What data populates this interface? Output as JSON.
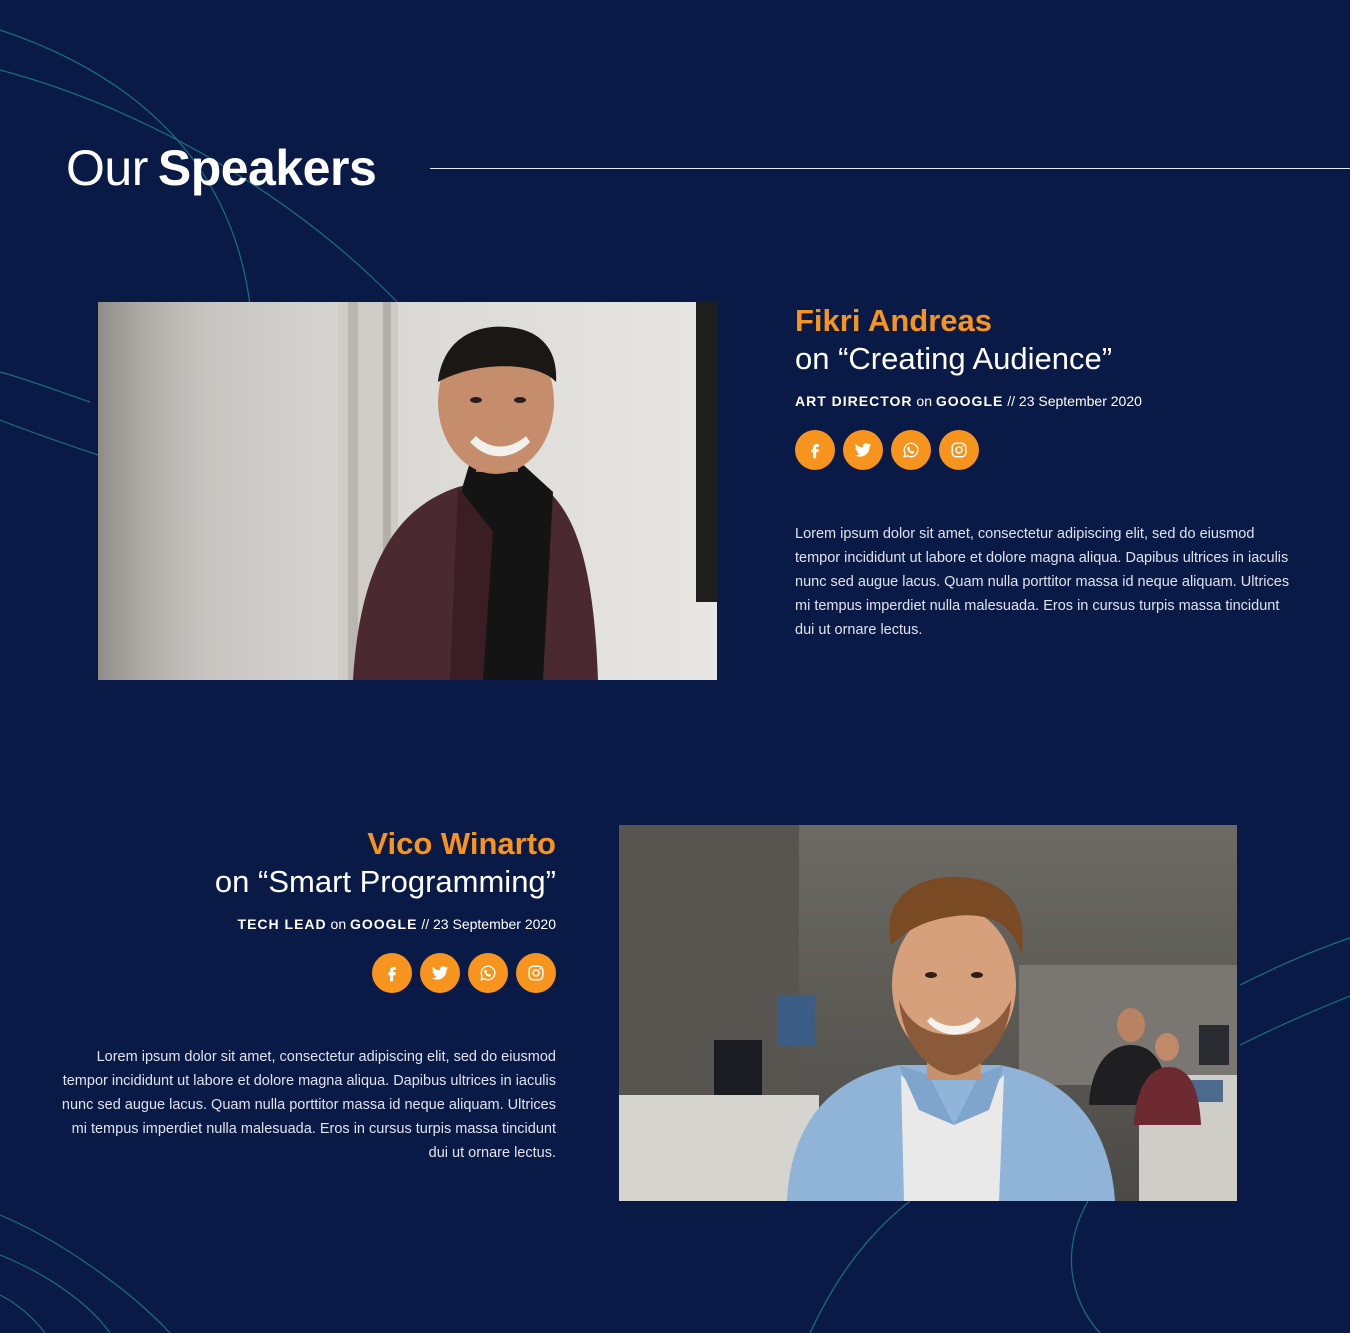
{
  "section": {
    "title_light": "Our",
    "title_bold": "Speakers"
  },
  "theme": {
    "background": "#0a1a47",
    "accent": "#f7941d",
    "decor_line": "#167a86"
  },
  "speakers": [
    {
      "name": "Fikri Andreas",
      "topic": "on “Creating Audience”",
      "role": "ART DIRECTOR",
      "on_word": "on",
      "company": "GOOGLE",
      "separator": "//",
      "date": "23 September 2020",
      "socials": [
        "facebook-icon",
        "twitter-icon",
        "whatsapp-icon",
        "instagram-icon"
      ],
      "bio": "Lorem ipsum dolor sit amet, consectetur adipiscing elit, sed do eiusmod tempor incididunt ut labore et dolore magna aliqua. Dapibus ultrices in iaculis nunc sed augue lacus. Quam nulla porttitor massa id neque aliquam. Ultrices mi tempus imperdiet nulla malesuada. Eros in cursus turpis massa tincidunt dui ut ornare lectus."
    },
    {
      "name": "Vico Winarto",
      "topic": "on “Smart Programming”",
      "role": "TECH LEAD",
      "on_word": "on",
      "company": "GOOGLE",
      "separator": "//",
      "date": "23 September 2020",
      "socials": [
        "facebook-icon",
        "twitter-icon",
        "whatsapp-icon",
        "instagram-icon"
      ],
      "bio": "Lorem ipsum dolor sit amet, consectetur adipiscing elit, sed do eiusmod tempor incididunt ut labore et dolore magna aliqua. Dapibus ultrices in iaculis nunc sed augue lacus. Quam nulla porttitor massa id neque aliquam. Ultrices mi tempus imperdiet nulla malesuada. Eros in cursus turpis massa tincidunt dui ut ornare lectus."
    }
  ]
}
